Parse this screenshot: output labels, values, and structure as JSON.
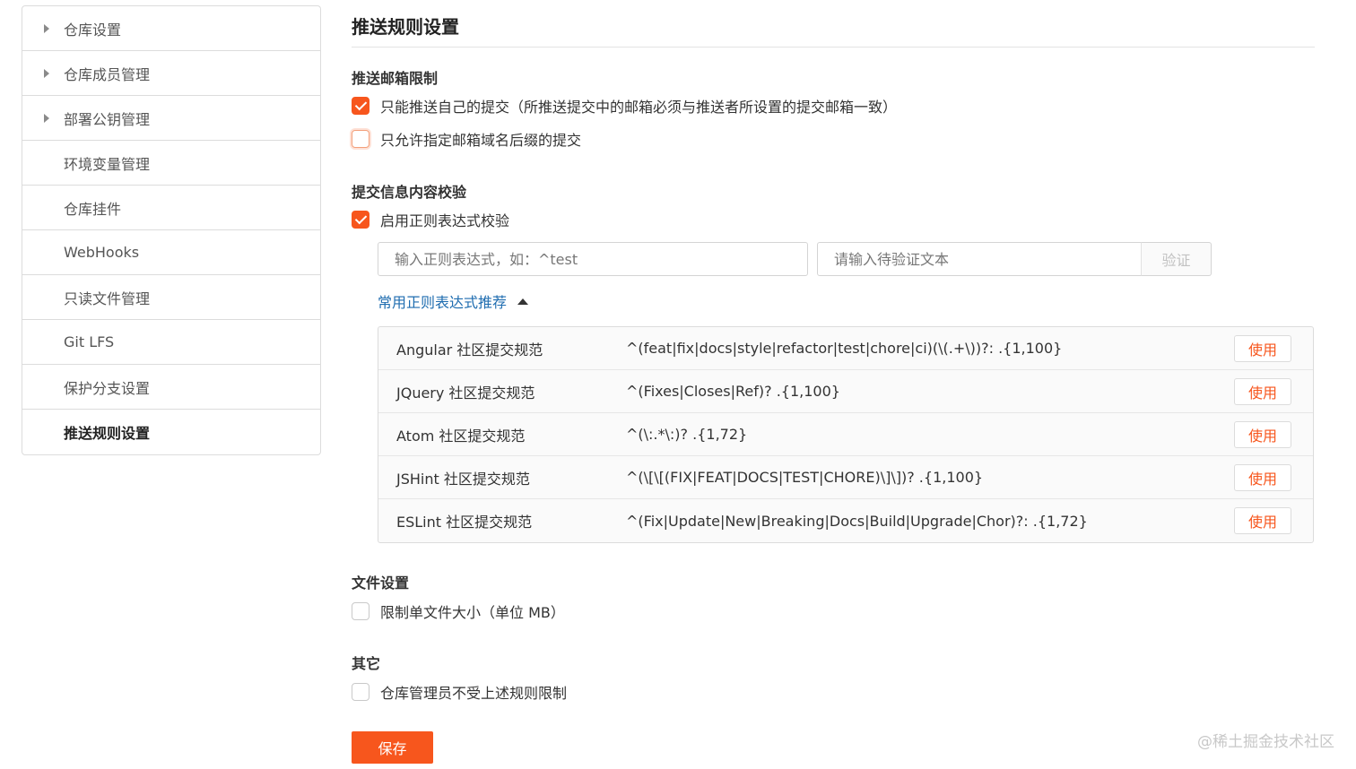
{
  "sidebar": {
    "items": [
      {
        "label": "仓库设置",
        "expandable": true
      },
      {
        "label": "仓库成员管理",
        "expandable": true
      },
      {
        "label": "部署公钥管理",
        "expandable": true
      },
      {
        "label": "环境变量管理",
        "expandable": false
      },
      {
        "label": "仓库挂件",
        "expandable": false
      },
      {
        "label": "WebHooks",
        "expandable": false
      },
      {
        "label": "只读文件管理",
        "expandable": false
      },
      {
        "label": "Git LFS",
        "expandable": false
      },
      {
        "label": "保护分支设置",
        "expandable": false
      },
      {
        "label": "推送规则设置",
        "expandable": false,
        "active": true
      }
    ]
  },
  "main": {
    "title": "推送规则设置",
    "email_section": {
      "title": "推送邮箱限制",
      "options": [
        {
          "label": "只能推送自己的提交（所推送提交中的邮箱必须与推送者所设置的提交邮箱一致）",
          "checked": true
        },
        {
          "label": "只允许指定邮箱域名后缀的提交",
          "checked": false
        }
      ]
    },
    "commit_section": {
      "title": "提交信息内容校验",
      "regex_option": {
        "label": "启用正则表达式校验",
        "checked": true
      },
      "regex_input": {
        "placeholder": "输入正则表达式，如：^test",
        "value": ""
      },
      "verify_input": {
        "placeholder": "请输入待验证文本",
        "value": ""
      },
      "verify_label": "验证",
      "recommend_toggle": "常用正则表达式推荐",
      "presets": [
        {
          "name": "Angular 社区提交规范",
          "pattern": "^(feat|fix|docs|style|refactor|test|chore|ci)(\\(.+\\))?: .{1,100}",
          "action": "使用"
        },
        {
          "name": "JQuery 社区提交规范",
          "pattern": "^(Fixes|Closes|Ref)? .{1,100}",
          "action": "使用"
        },
        {
          "name": "Atom 社区提交规范",
          "pattern": "^(\\:.*\\:)? .{1,72}",
          "action": "使用"
        },
        {
          "name": "JSHint 社区提交规范",
          "pattern": "^(\\[\\[(FIX|FEAT|DOCS|TEST|CHORE)\\]\\])? .{1,100}",
          "action": "使用"
        },
        {
          "name": "ESLint 社区提交规范",
          "pattern": "^(Fix|Update|New|Breaking|Docs|Build|Upgrade|Chor)?: .{1,72}",
          "action": "使用"
        }
      ]
    },
    "file_section": {
      "title": "文件设置",
      "option": {
        "label": "限制单文件大小（单位 MB）",
        "checked": false
      }
    },
    "other_section": {
      "title": "其它",
      "option": {
        "label": "仓库管理员不受上述规则限制",
        "checked": false
      }
    },
    "save_label": "保存"
  },
  "watermark": "@稀土掘金技术社区",
  "colors": {
    "accent": "#f7561d",
    "link": "#1f6db0",
    "border": "#dcdcdc"
  }
}
